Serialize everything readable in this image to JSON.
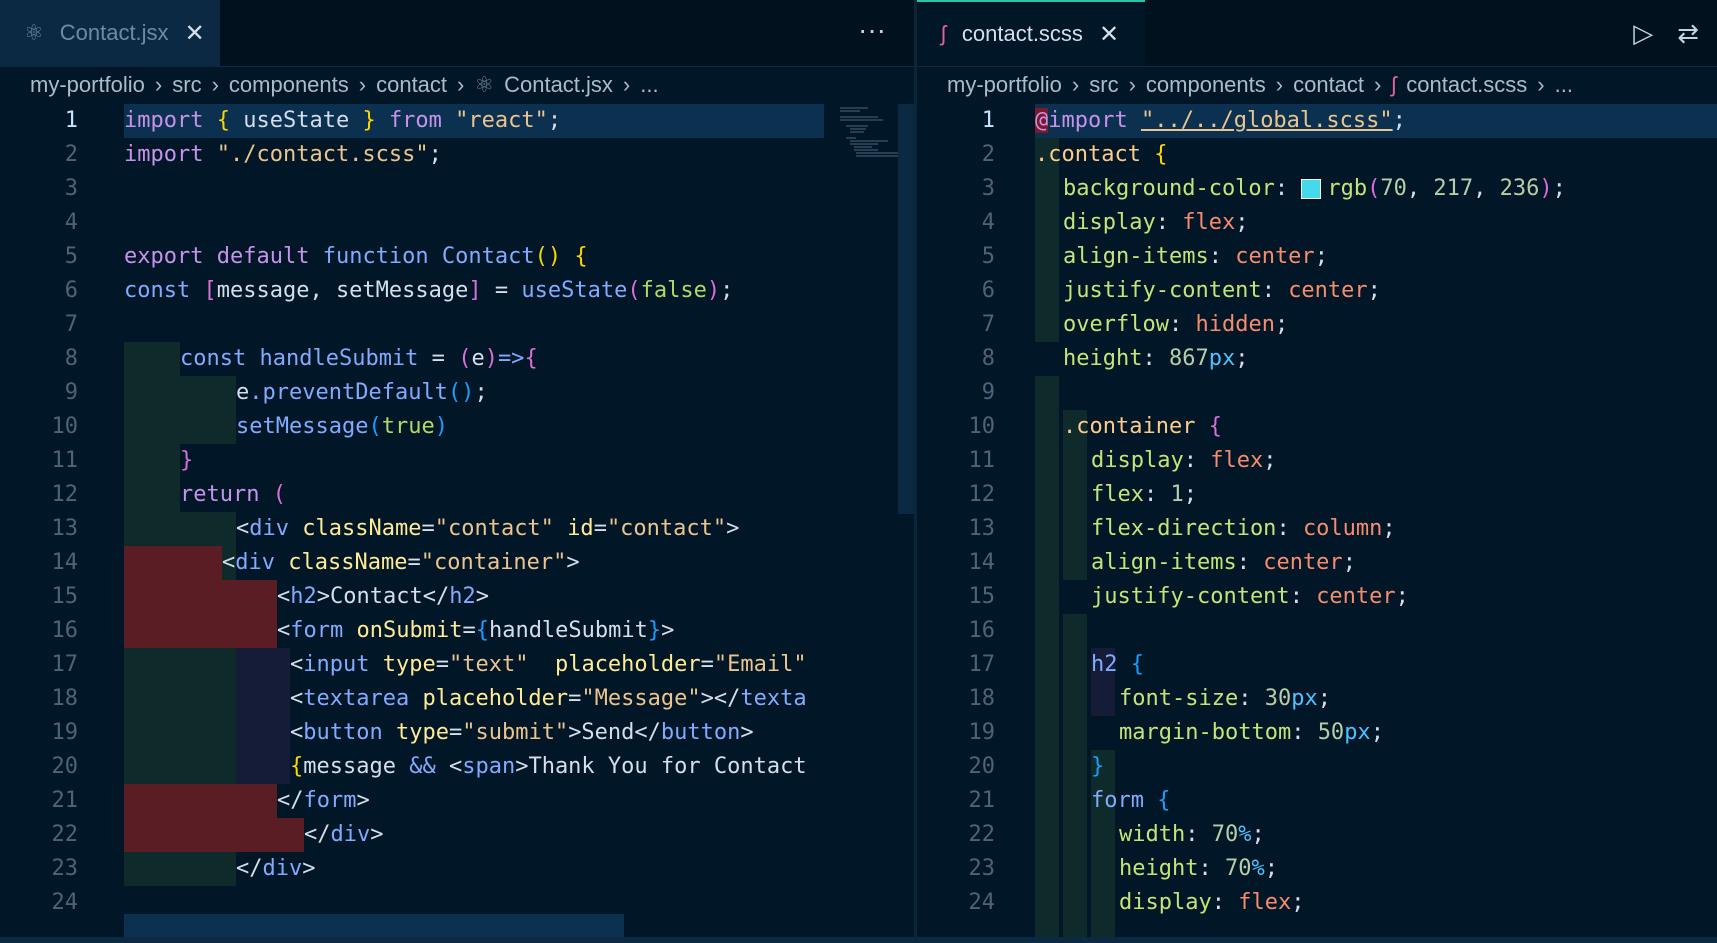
{
  "left": {
    "tab": {
      "label": "Contact.jsx",
      "icon": "react-icon",
      "close": "✕"
    },
    "more": "···",
    "breadcrumb": [
      "my-portfolio",
      "src",
      "components",
      "contact",
      "Contact.jsx",
      "..."
    ],
    "lines": [
      "1",
      "2",
      "3",
      "4",
      "5",
      "6",
      "7",
      "8",
      "9",
      "10",
      "11",
      "12",
      "13",
      "14",
      "15",
      "16",
      "17",
      "18",
      "19",
      "20",
      "21",
      "22",
      "23",
      "24"
    ]
  },
  "right": {
    "tab": {
      "label": "contact.scss",
      "icon": "sass-icon",
      "close": "✕"
    },
    "actions": {
      "run": "▷",
      "compare": "⇄"
    },
    "breadcrumb": [
      "my-portfolio",
      "src",
      "components",
      "contact",
      "contact.scss",
      "..."
    ],
    "lines": [
      "1",
      "2",
      "3",
      "4",
      "5",
      "6",
      "7",
      "8",
      "9",
      "10",
      "11",
      "12",
      "13",
      "14",
      "15",
      "16",
      "17",
      "18",
      "19",
      "20",
      "21",
      "22",
      "23",
      "24"
    ]
  },
  "colors": {
    "background": "#011627",
    "accent": "#21c7a8",
    "swatch": "#46d9ec"
  }
}
